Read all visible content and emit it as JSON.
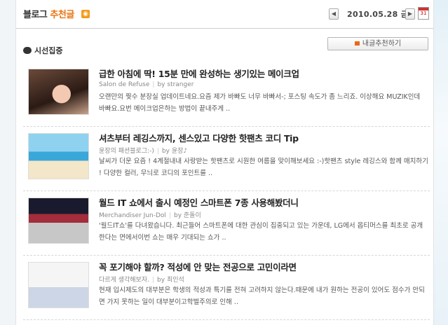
{
  "header": {
    "title_plain": "블로그",
    "title_accent": "추천글",
    "rss_icon": "rss-icon",
    "date_display": "2010.05.28 금"
  },
  "section": {
    "title": "시선집중",
    "recommend_button": "내글추천하기"
  },
  "articles": [
    {
      "title": "급한 아침에 딱! 15분 만에 완성하는 생기있는 메이크업",
      "blog": "Salon de Refuse",
      "by": "by",
      "author": "stranger",
      "description": "오랜만의 찢수 분장실 업데이트네요.요즘 제가 바빠도 너무 바빠서-; 포스팅 속도가 좀 느리죠. 이상해요 MUZIK인데 바빠요.요번 메이크업은하는 방법이 끝내주게 .."
    },
    {
      "title": "셔츠부터 레깅스까지, 센스있고 다양한 핫팬츠 코디 Tip",
      "blog": "윤장의 패션블로그:-)",
      "by": "by",
      "author": "윤장♪",
      "description": "날씨가 더운 요즘 ! 4계절내내 사랑받는 핫팬츠로 시원한 여름을 맞이해보세요 :-)핫팬츠 style 레깅스와 함께 매치하기 ! 다양한 컬러, 무늬로 코디의 포인트를 .."
    },
    {
      "title": "월드 IT 쇼에서 출시 예정인 스마트폰 7종 사용해봤더니",
      "blog": "Merchandiser Jun-Dol",
      "by": "by",
      "author": "준돌이",
      "description": "'월드IT쇼'를 다녀왔습니다. 최근들어 스마트폰에 대한 관심이 집중되고 있는 가운데, LG에서 옵티머스를 최초로 공개한다는 면에서이번 쇼는 매우 기대되는 쇼가 .."
    },
    {
      "title": "꼭 포기해야 할까? 적성에 안 맞는 전공으로 고민이라면",
      "blog": "다르게 생각해보자.",
      "by": "by",
      "author": "최인석",
      "description": "현재 입시제도의 대부분은 학생의 적성과 특기를 전혀 고려하지 않는다.때문에 내가 원하는 전공이 있어도 점수가 안되면 가지 못하는 일이 대부분이고학벌주의로 인해 .."
    }
  ]
}
